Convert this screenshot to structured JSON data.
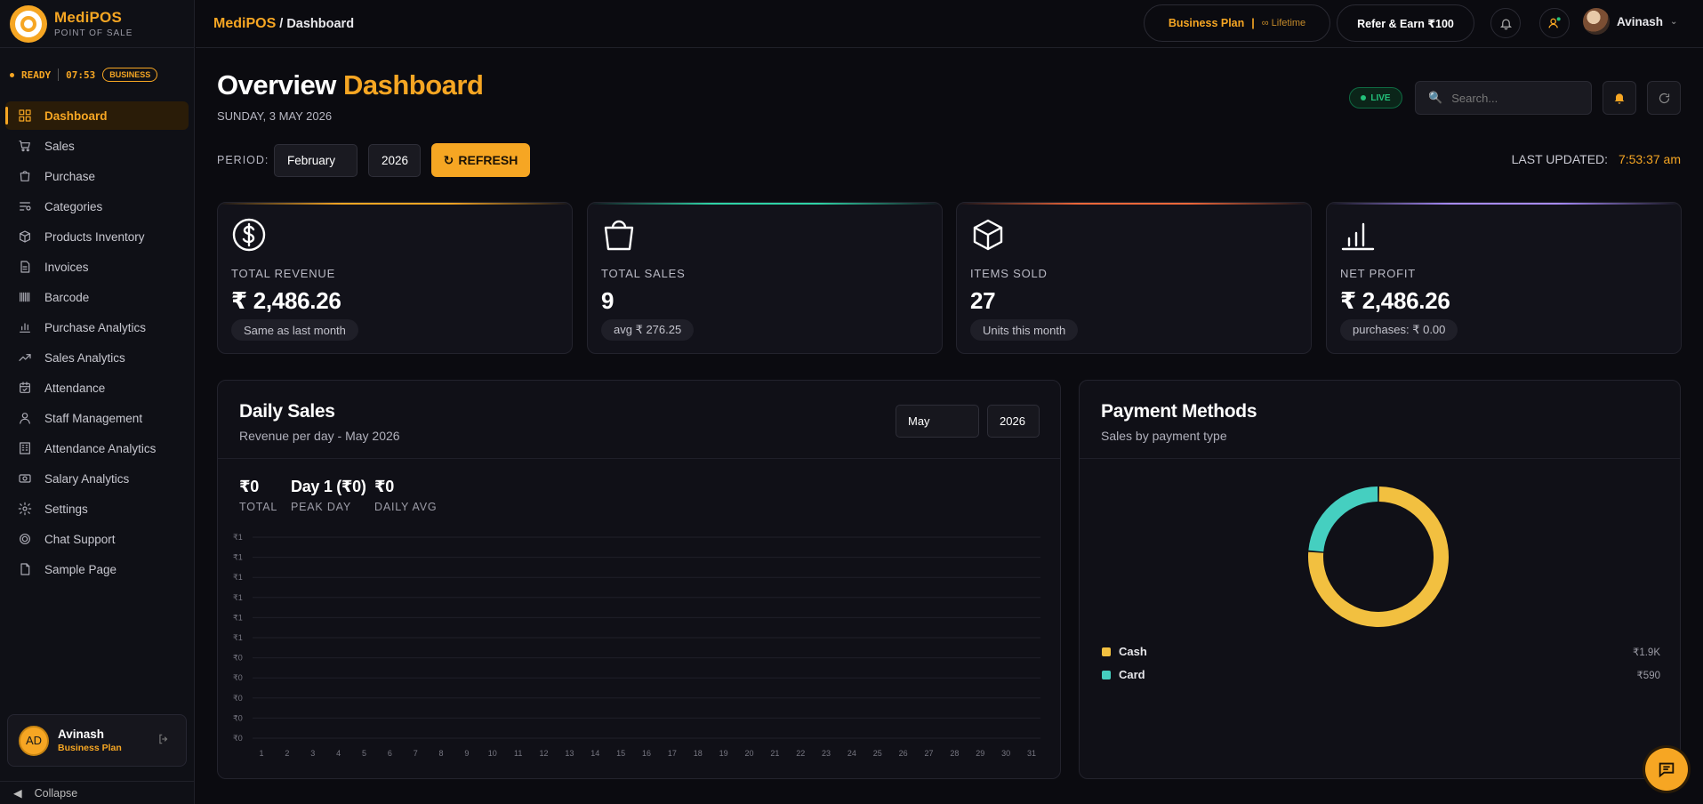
{
  "brand": {
    "name": "MediPOS",
    "subtitle": "POINT OF SALE"
  },
  "status": {
    "state": "READY",
    "time": "07:53",
    "plan_badge": "BUSINESS"
  },
  "sidebar": {
    "items": [
      {
        "label": "Dashboard",
        "icon": "grid-icon",
        "active": true
      },
      {
        "label": "Sales",
        "icon": "cart-icon"
      },
      {
        "label": "Purchase",
        "icon": "bag-icon"
      },
      {
        "label": "Categories",
        "icon": "list-filter-icon"
      },
      {
        "label": "Products Inventory",
        "icon": "box-icon"
      },
      {
        "label": "Invoices",
        "icon": "file-icon"
      },
      {
        "label": "Barcode",
        "icon": "barcode-icon"
      },
      {
        "label": "Purchase Analytics",
        "icon": "bar-chart-icon"
      },
      {
        "label": "Sales Analytics",
        "icon": "trend-icon"
      },
      {
        "label": "Attendance",
        "icon": "calendar-icon"
      },
      {
        "label": "Staff Management",
        "icon": "user-icon"
      },
      {
        "label": "Attendance Analytics",
        "icon": "building-icon"
      },
      {
        "label": "Salary Analytics",
        "icon": "banknote-icon"
      },
      {
        "label": "Settings",
        "icon": "gear-icon"
      },
      {
        "label": "Chat Support",
        "icon": "chat-gear-icon"
      },
      {
        "label": "Sample Page",
        "icon": "document-icon"
      }
    ],
    "user": {
      "initials": "AD",
      "name": "Avinash",
      "plan": "Business Plan"
    },
    "collapse_label": "Collapse"
  },
  "topbar": {
    "breadcrumb_root": "MediPOS",
    "breadcrumb_page": " / Dashboard",
    "plan_label": "Business Plan",
    "plan_sep": "|",
    "plan_term": "∞ Lifetime",
    "refer_label": "Refer & Earn ₹100",
    "user_name": "Avinash"
  },
  "header": {
    "title_main": "Overview",
    "title_accent": "Dashboard",
    "date": "SUNDAY, 3 MAY 2026",
    "live_label": "LIVE",
    "search_placeholder": "Search..."
  },
  "filters": {
    "period_label": "PERIOD:",
    "month": "February",
    "year": "2026",
    "refresh_label": "REFRESH",
    "last_updated_label": "LAST UPDATED:",
    "last_updated_time": "7:53:37 am"
  },
  "stats": [
    {
      "label": "TOTAL REVENUE",
      "value": "₹ 2,486.26",
      "chip": "Same as last month",
      "icon": "dollar-circle-icon",
      "accent": "#f6a623"
    },
    {
      "label": "TOTAL SALES",
      "value": "9",
      "chip": "avg ₹ 276.25",
      "icon": "shopping-bag-icon",
      "accent": "#2fd3a6"
    },
    {
      "label": "ITEMS SOLD",
      "value": "27",
      "chip": "Units this month",
      "icon": "cube-icon",
      "accent": "#f2683a"
    },
    {
      "label": "NET PROFIT",
      "value": "₹ 2,486.26",
      "chip": "purchases: ₹ 0.00",
      "icon": "signal-bars-icon",
      "accent": "#a78bfa"
    }
  ],
  "daily_sales": {
    "title": "Daily Sales",
    "subtitle": "Revenue per day - May 2026",
    "month": "May",
    "year": "2026",
    "kpis": [
      {
        "value": "₹0",
        "label": "TOTAL"
      },
      {
        "value": "Day 1 (₹0)",
        "label": "PEAK DAY"
      },
      {
        "value": "₹0",
        "label": "DAILY AVG"
      }
    ]
  },
  "payment_methods": {
    "title": "Payment Methods",
    "subtitle": "Sales by payment type",
    "legend": [
      {
        "name": "Cash",
        "amount": "₹1.9K",
        "color": "#f2c040"
      },
      {
        "name": "Card",
        "amount": "₹590",
        "color": "#45cfc0"
      }
    ]
  },
  "chart_data": [
    {
      "type": "line",
      "title": "Daily Sales",
      "x": [
        1,
        2,
        3,
        4,
        5,
        6,
        7,
        8,
        9,
        10,
        11,
        12,
        13,
        14,
        15,
        16,
        17,
        18,
        19,
        20,
        21,
        22,
        23,
        24,
        25,
        26,
        27,
        28,
        29,
        30,
        31
      ],
      "series": [
        {
          "values": [
            0,
            0,
            0,
            0,
            0,
            0,
            0,
            0,
            0,
            0,
            0,
            0,
            0,
            0,
            0,
            0,
            0,
            0,
            0,
            0,
            0,
            0,
            0,
            0,
            0,
            0,
            0,
            0,
            0,
            0,
            0
          ]
        }
      ],
      "y_tick_labels": [
        "₹1",
        "₹1",
        "₹1",
        "₹1",
        "₹1",
        "₹1",
        "₹0",
        "₹0",
        "₹0",
        "₹0",
        "₹0"
      ],
      "grid": true
    },
    {
      "type": "pie",
      "title": "Payment Methods",
      "categories": [
        "Cash",
        "Card"
      ],
      "values": [
        1896,
        590
      ],
      "colors": [
        "#f2c040",
        "#45cfc0"
      ],
      "donut": true
    }
  ]
}
